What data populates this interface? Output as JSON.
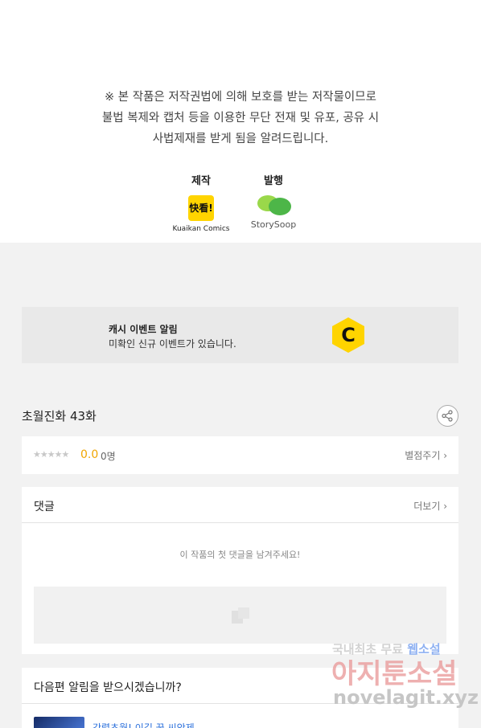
{
  "copyright": {
    "line1": "※ 본 작품은 저작권법에 의해 보호를 받는 저작물이므로",
    "line2": "불법 복제와 캡처 등을 이용한 무단 전재 및 유포, 공유 시",
    "line3": "사법제재를 받게 됨을 알려드립니다."
  },
  "credits": {
    "producer_label": "제작",
    "producer_logo_text": "快看!",
    "producer_name": "Kuaikan Comics",
    "publisher_label": "발행",
    "publisher_name": "StorySoop"
  },
  "cash_event": {
    "title": "캐시 이벤트 알림",
    "subtitle": "미확인 신규 이벤트가 있습니다.",
    "icon": "cash-c-icon",
    "icon_letter": "C",
    "accent": "#ffd400"
  },
  "episode": {
    "title": "초월진화 43화",
    "share_icon": "share-icon"
  },
  "rating": {
    "stars": "★★★★★",
    "stars_filled": 0,
    "score": "0.0",
    "count": "0명",
    "rate_link": "별점주기 ›"
  },
  "comments": {
    "title": "댓글",
    "more_link": "더보기 ›",
    "empty_message": "이 작품의 첫 댓글을 남겨주세요!"
  },
  "notify": {
    "title": "다음편 알림을 받으시겠습니까?",
    "item_text": "강렬초월! 이길 꿈 씨앗제"
  },
  "watermark": {
    "line1_prefix": "국내최초 무료 ",
    "line1_highlight": "웹소설",
    "line2": "아지툰소설",
    "line3": "novelagit.xyz"
  }
}
